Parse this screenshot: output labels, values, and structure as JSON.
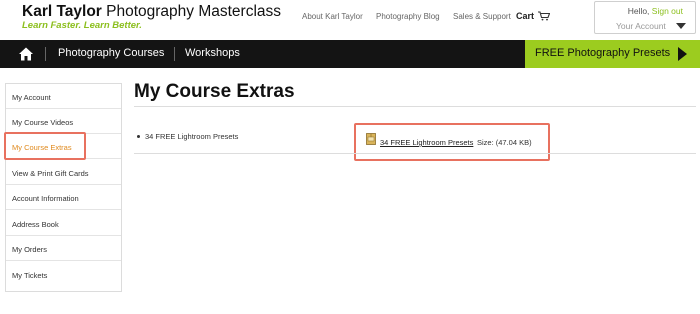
{
  "header": {
    "logo": {
      "name_bold": "Karl Taylor",
      "name_rest": "Photography Masterclass",
      "tagline": "Learn Faster. Learn Better."
    },
    "links": [
      {
        "label": "About Karl Taylor"
      },
      {
        "label": "Photography Blog"
      },
      {
        "label": "Sales & Support"
      }
    ],
    "cart_label": "Cart",
    "account": {
      "hello": "Hello,",
      "sign_out": "Sign out",
      "your_account": "Your Account"
    }
  },
  "navbar": {
    "items": [
      {
        "label": "Photography Courses"
      },
      {
        "label": "Workshops"
      }
    ],
    "cta_label": "FREE Photography Presets",
    "cta_color": "#9ccc1f"
  },
  "sidebar": {
    "items": [
      {
        "label": "My Account",
        "active": false
      },
      {
        "label": "My Course Videos",
        "active": false
      },
      {
        "label": "My Course Extras",
        "active": true
      },
      {
        "label": "View & Print Gift Cards",
        "active": false
      },
      {
        "label": "Account Information",
        "active": false
      },
      {
        "label": "Address Book",
        "active": false
      },
      {
        "label": "My Orders",
        "active": false
      },
      {
        "label": "My Tickets",
        "active": false
      }
    ],
    "active_color": "#e08a1e"
  },
  "main": {
    "title": "My Course Extras",
    "extras": [
      {
        "name": "34 FREE Lightroom Presets",
        "file_label": "34 FREE Lightroom Presets",
        "size_text": "Size: (47.04 KB)",
        "icon": "file-archive-icon"
      }
    ]
  },
  "colors": {
    "brand_green": "#8cbf1e",
    "highlight": "#e8715f",
    "navbar_bg": "#141414"
  }
}
